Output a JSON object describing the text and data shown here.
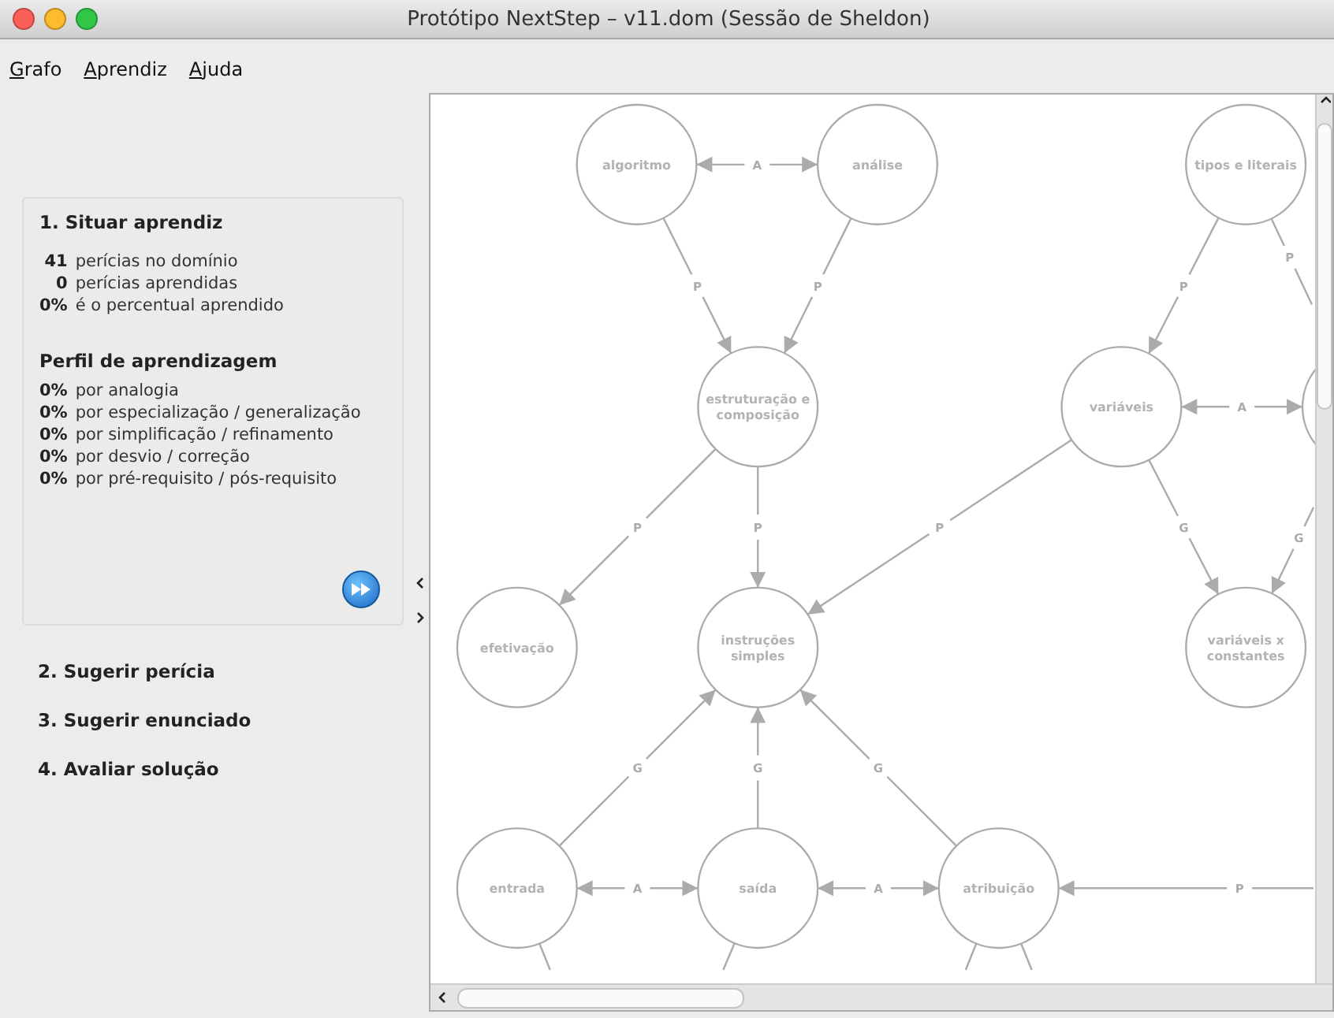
{
  "window": {
    "title": "Protótipo NextStep – v11.dom (Sessão de Sheldon)"
  },
  "menu": [
    {
      "label": "Grafo"
    },
    {
      "label": "Aprendiz"
    },
    {
      "label": "Ajuda"
    }
  ],
  "steps": [
    {
      "title": "1. Situar aprendiz",
      "expanded": true
    },
    {
      "title": "2. Sugerir perícia",
      "expanded": false
    },
    {
      "title": "3. Sugerir enunciado",
      "expanded": false
    },
    {
      "title": "4. Avaliar solução",
      "expanded": false
    }
  ],
  "stats": [
    {
      "value": "41",
      "text": "perícias no domínio"
    },
    {
      "value": "0",
      "text": "perícias aprendidas"
    },
    {
      "value": "0%",
      "text": "é o percentual aprendido"
    }
  ],
  "profile": {
    "title": "Perfil de aprendizagem",
    "rows": [
      {
        "value": "0%",
        "text": "por analogia"
      },
      {
        "value": "0%",
        "text": "por especialização / generalização"
      },
      {
        "value": "0%",
        "text": "por simplificação / refinamento"
      },
      {
        "value": "0%",
        "text": "por desvio / correção"
      },
      {
        "value": "0%",
        "text": "por pré-requisito / pós-requisito"
      }
    ]
  },
  "graph": {
    "nodes": [
      {
        "label": "algoritmo"
      },
      {
        "label": "análise"
      },
      {
        "label": "tipos e literais"
      },
      {
        "label": "estruturação e composição"
      },
      {
        "label": "variáveis"
      },
      {
        "label": "efetivação"
      },
      {
        "label": "instruções simples"
      },
      {
        "label": "variáveis x constantes"
      },
      {
        "label": "entrada"
      },
      {
        "label": "saída"
      },
      {
        "label": "atribuição"
      }
    ],
    "edges": [
      {
        "label": "A"
      },
      {
        "label": "P"
      },
      {
        "label": "P"
      },
      {
        "label": "P"
      },
      {
        "label": "P"
      },
      {
        "label": "A"
      },
      {
        "label": "P"
      },
      {
        "label": "P"
      },
      {
        "label": "P"
      },
      {
        "label": "G"
      },
      {
        "label": "G"
      },
      {
        "label": "G"
      },
      {
        "label": "G"
      },
      {
        "label": "G"
      },
      {
        "label": "A"
      },
      {
        "label": "A"
      },
      {
        "label": "P"
      }
    ]
  }
}
